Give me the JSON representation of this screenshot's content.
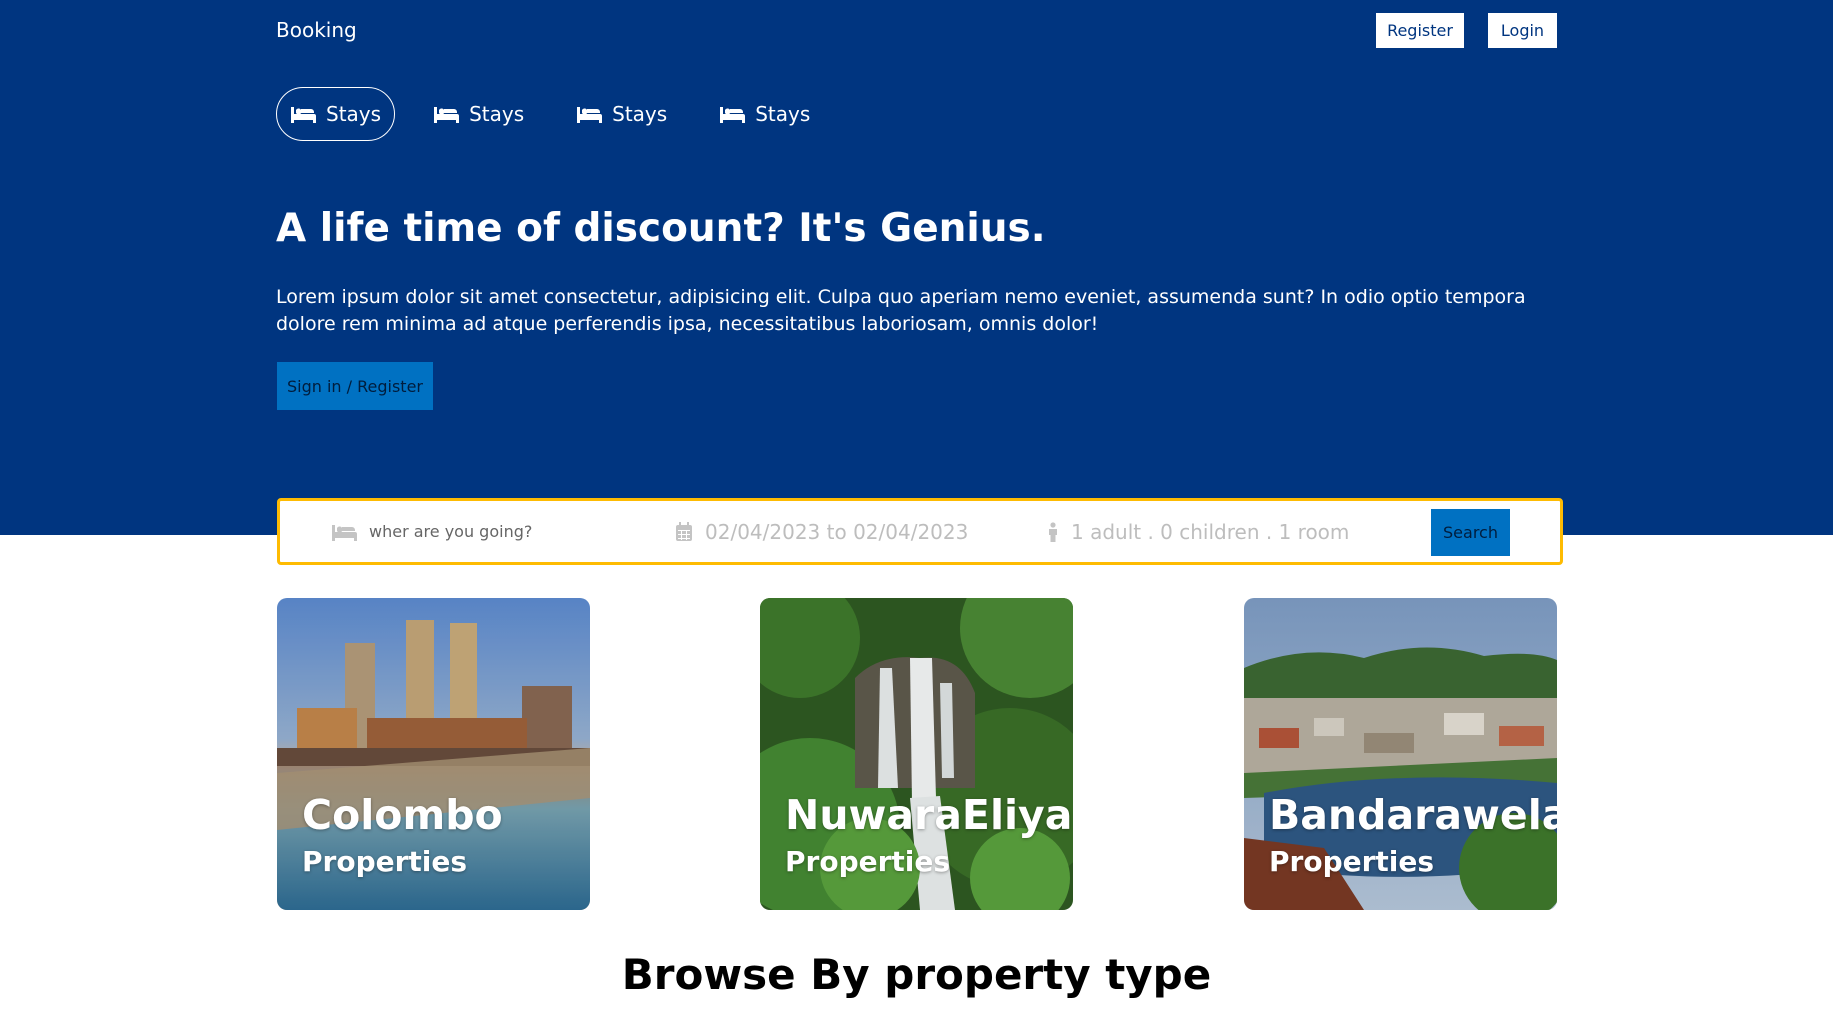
{
  "colors": {
    "primary": "#003580",
    "accent_blue": "#0071c2",
    "search_border": "#febb02"
  },
  "header": {
    "brand": "Booking",
    "register_label": "Register",
    "login_label": "Login"
  },
  "tabs": [
    {
      "label": "Stays",
      "icon": "bed-icon",
      "active": true
    },
    {
      "label": "Stays",
      "icon": "bed-icon",
      "active": false
    },
    {
      "label": "Stays",
      "icon": "bed-icon",
      "active": false
    },
    {
      "label": "Stays",
      "icon": "bed-icon",
      "active": false
    }
  ],
  "hero": {
    "title": "A life time of discount? It's Genius.",
    "description": "Lorem ipsum dolor sit amet consectetur, adipisicing elit. Culpa quo aperiam nemo eveniet, assumenda sunt? In odio optio tempora dolore rem minima ad atque perferendis ipsa, necessitatibus laboriosam, omnis dolor!",
    "cta_label": "Sign in / Register"
  },
  "search": {
    "destination_placeholder": "wher are you going?",
    "destination_icon": "bed-icon",
    "date_text": "02/04/2023 to 02/04/2023",
    "date_icon": "calendar-icon",
    "guests_text": "1 adult . 0 children . 1 room",
    "guests_icon": "person-icon",
    "button_label": "Search"
  },
  "cards": [
    {
      "city": "Colombo",
      "subtitle": "Properties"
    },
    {
      "city": "NuwaraEliya",
      "subtitle": "Properties"
    },
    {
      "city": "Bandarawela",
      "subtitle": "Properties"
    }
  ],
  "next_section": {
    "title": "Browse By property type"
  }
}
